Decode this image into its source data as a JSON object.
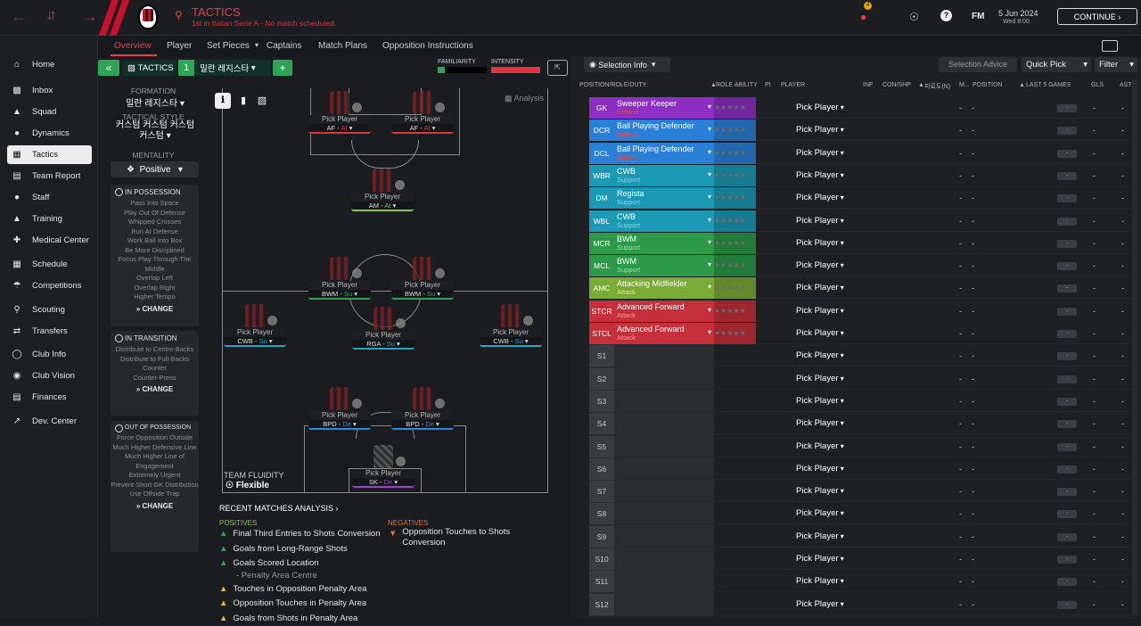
{
  "topbar": {
    "title": "TACTICS",
    "subtitle": "1st in Italian Serie A - No match scheduled.",
    "date": "5 Jun 2024",
    "time": "Wed 8:00",
    "continue": "CONTINUE",
    "fm": "FM",
    "badge": "4"
  },
  "subnav": [
    "Overview",
    "Player",
    "Set Pieces",
    "Captains",
    "Match Plans",
    "Opposition Instructions"
  ],
  "sidebar": [
    "Home",
    "Inbox",
    "Squad",
    "Dynamics",
    "Tactics",
    "Team Report",
    "Staff",
    "Training",
    "Medical Center",
    "Schedule",
    "Competitions",
    "Scouting",
    "Transfers",
    "Club Info",
    "Club Vision",
    "Finances",
    "Dev. Center"
  ],
  "tacbar": {
    "tactics": "TACTICS",
    "num": "1",
    "name": "밀란 레지스타",
    "familiarity": "FAMILIARITY",
    "intensity": "INTENSITY"
  },
  "left": {
    "formation_label": "FORMATION",
    "formation": "밀란 레지스타",
    "style_label": "TACTICAL STYLE",
    "style": "커스텀 커스텀 커스텀 커스텀",
    "mentality_label": "MENTALITY",
    "mentality": "Positive",
    "in_possession": "IN POSSESSION",
    "in_possession_items": [
      "Pass Into Space",
      "Play Out Of Defense",
      "Whipped Crosses",
      "Run At Defense",
      "Work Ball Into Box",
      "Be More Disciplined",
      "Focus Play Through The Middle",
      "Overlap Left",
      "Overlap Right",
      "Higher Tempo"
    ],
    "in_transition": "IN TRANSITION",
    "in_transition_items": [
      "Distribute to Centre-Backs",
      "Distribute to Full-Backs",
      "Counter",
      "Counter-Press"
    ],
    "out_possession": "OUT OF POSSESSION",
    "out_possession_items": [
      "Force Opposition Outside",
      "Much Higher Defensive Line",
      "Much Higher Line of Engagement",
      "Extremely Urgent",
      "Prevent Short GK Distribution",
      "Use Offside Trap"
    ],
    "change": "CHANGE"
  },
  "pitch": {
    "analysis": "Analysis",
    "fluidity_label": "TEAM FLUIDITY",
    "fluidity": "Flexible",
    "pick": "Pick Player",
    "players": [
      {
        "role": "AF",
        "duty": "At",
        "color": "#d93a3a"
      },
      {
        "role": "AF",
        "duty": "At",
        "color": "#d93a3a"
      },
      {
        "role": "AM",
        "duty": "At",
        "color": "#8bc34a"
      },
      {
        "role": "BWM",
        "duty": "Su",
        "color": "#2ea457"
      },
      {
        "role": "BWM",
        "duty": "Su",
        "color": "#2ea457"
      },
      {
        "role": "CWB",
        "duty": "Su",
        "color": "#1fa7c4"
      },
      {
        "role": "RGA",
        "duty": "Su",
        "color": "#1fa7c4"
      },
      {
        "role": "CWB",
        "duty": "Su",
        "color": "#1fa7c4"
      },
      {
        "role": "BPD",
        "duty": "De",
        "color": "#2d8ae0"
      },
      {
        "role": "BPD",
        "duty": "De",
        "color": "#2d8ae0"
      },
      {
        "role": "SK",
        "duty": "De",
        "color": "#9b3fd1"
      }
    ]
  },
  "analysis": {
    "title": "RECENT MATCHES ANALYSIS",
    "pos_label": "POSITIVES",
    "neg_label": "NEGATIVES",
    "positives": [
      "Final Third Entries to Shots Conversion",
      "Goals from Long-Range Shots",
      "Goals Scored Location",
      "- Penalty Area Centre",
      "Touches in Opposition Penalty Area",
      "Opposition Touches in Penalty Area",
      "Goals from Shots in Penalty Area"
    ],
    "negatives": [
      "Opposition Touches to Shots Conversion"
    ]
  },
  "right": {
    "selection_info": "Selection Info",
    "selection_advice": "Selection Advice",
    "quick_pick": "Quick Pick",
    "filter": "Filter",
    "headers": [
      "POSITION/ROLE/DUTY",
      "ROLE ABILITY",
      "PI",
      "PLAYER",
      "INF",
      "CON/SHP",
      "피로도(N)",
      "M...",
      "POSITION",
      "LAST 5 GAMES",
      "GLS",
      "AST"
    ],
    "rows": [
      {
        "pos": "GK",
        "role": "Sweeper Keeper",
        "duty": "Defend",
        "color": "#8e2fc4",
        "dcol": "#e84a4a"
      },
      {
        "pos": "DCR",
        "role": "Ball Playing Defender",
        "duty": "Defend",
        "color": "#2a7fd6",
        "dcol": "#e84a4a"
      },
      {
        "pos": "DCL",
        "role": "Ball Playing Defender",
        "duty": "Defend",
        "color": "#2a7fd6",
        "dcol": "#e84a4a"
      },
      {
        "pos": "WBR",
        "role": "CWB",
        "duty": "Support",
        "color": "#1c9ab5",
        "dcol": "#7fd6ef"
      },
      {
        "pos": "DM",
        "role": "Regista",
        "duty": "Support",
        "color": "#1c9ab5",
        "dcol": "#7fd6ef"
      },
      {
        "pos": "WBL",
        "role": "CWB",
        "duty": "Support",
        "color": "#1c9ab5",
        "dcol": "#7fd6ef"
      },
      {
        "pos": "MCR",
        "role": "BWM",
        "duty": "Support",
        "color": "#2c9a48",
        "dcol": "#8fe3a8"
      },
      {
        "pos": "MCL",
        "role": "BWM",
        "duty": "Support",
        "color": "#2c9a48",
        "dcol": "#8fe3a8"
      },
      {
        "pos": "AMC",
        "role": "Attacking Midfielder",
        "duty": "Attack",
        "color": "#7aab34",
        "dcol": "#d8f0a8"
      },
      {
        "pos": "STCR",
        "role": "Advanced Forward",
        "duty": "Attack",
        "color": "#c5303a",
        "dcol": "#ff9a9a"
      },
      {
        "pos": "STCL",
        "role": "Advanced Forward",
        "duty": "Attack",
        "color": "#c5303a",
        "dcol": "#ff9a9a"
      },
      {
        "pos": "S1"
      },
      {
        "pos": "S2"
      },
      {
        "pos": "S3"
      },
      {
        "pos": "S4"
      },
      {
        "pos": "S5"
      },
      {
        "pos": "S6"
      },
      {
        "pos": "S7"
      },
      {
        "pos": "S8"
      },
      {
        "pos": "S9"
      },
      {
        "pos": "S10"
      },
      {
        "pos": "S11"
      },
      {
        "pos": "S12"
      }
    ],
    "pick": "Pick Player",
    "dash": "-"
  }
}
